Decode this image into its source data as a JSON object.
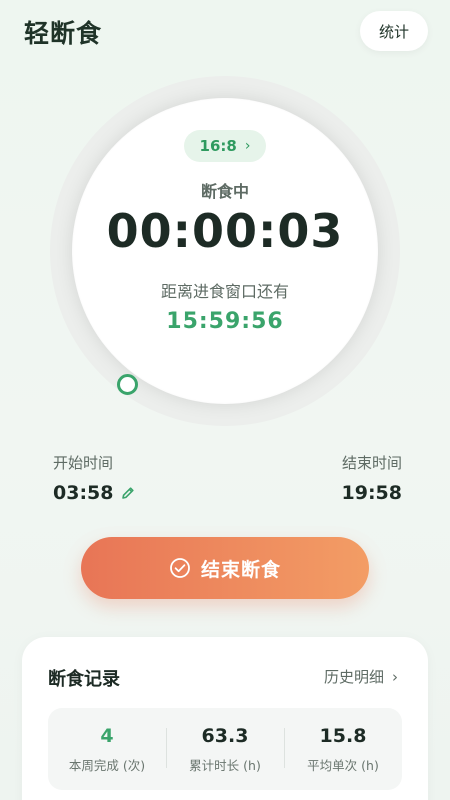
{
  "header": {
    "app_title": "轻断食",
    "stats_button": "统计"
  },
  "timer": {
    "plan_label": "16:8",
    "plan_chevron": "›",
    "status": "断食中",
    "elapsed": "00:00:03",
    "remaining_label": "距离进食窗口还有",
    "remaining": "15:59:56",
    "progress_fraction": 0.0001
  },
  "schedule": {
    "start_label": "开始时间",
    "start_time": "03:58",
    "end_label": "结束时间",
    "end_time": "19:58"
  },
  "action": {
    "end_fast_label": "结束断食"
  },
  "records": {
    "title": "断食记录",
    "history_link": "历史明细",
    "history_chevron": "›",
    "stats": [
      {
        "value": "4",
        "label": "本周完成 (次)"
      },
      {
        "value": "63.3",
        "label": "累计时长 (h)"
      },
      {
        "value": "15.8",
        "label": "平均单次 (h)"
      }
    ]
  },
  "colors": {
    "accent_green": "#3aa46b",
    "end_button_start": "#e87556",
    "end_button_end": "#f39d65"
  }
}
